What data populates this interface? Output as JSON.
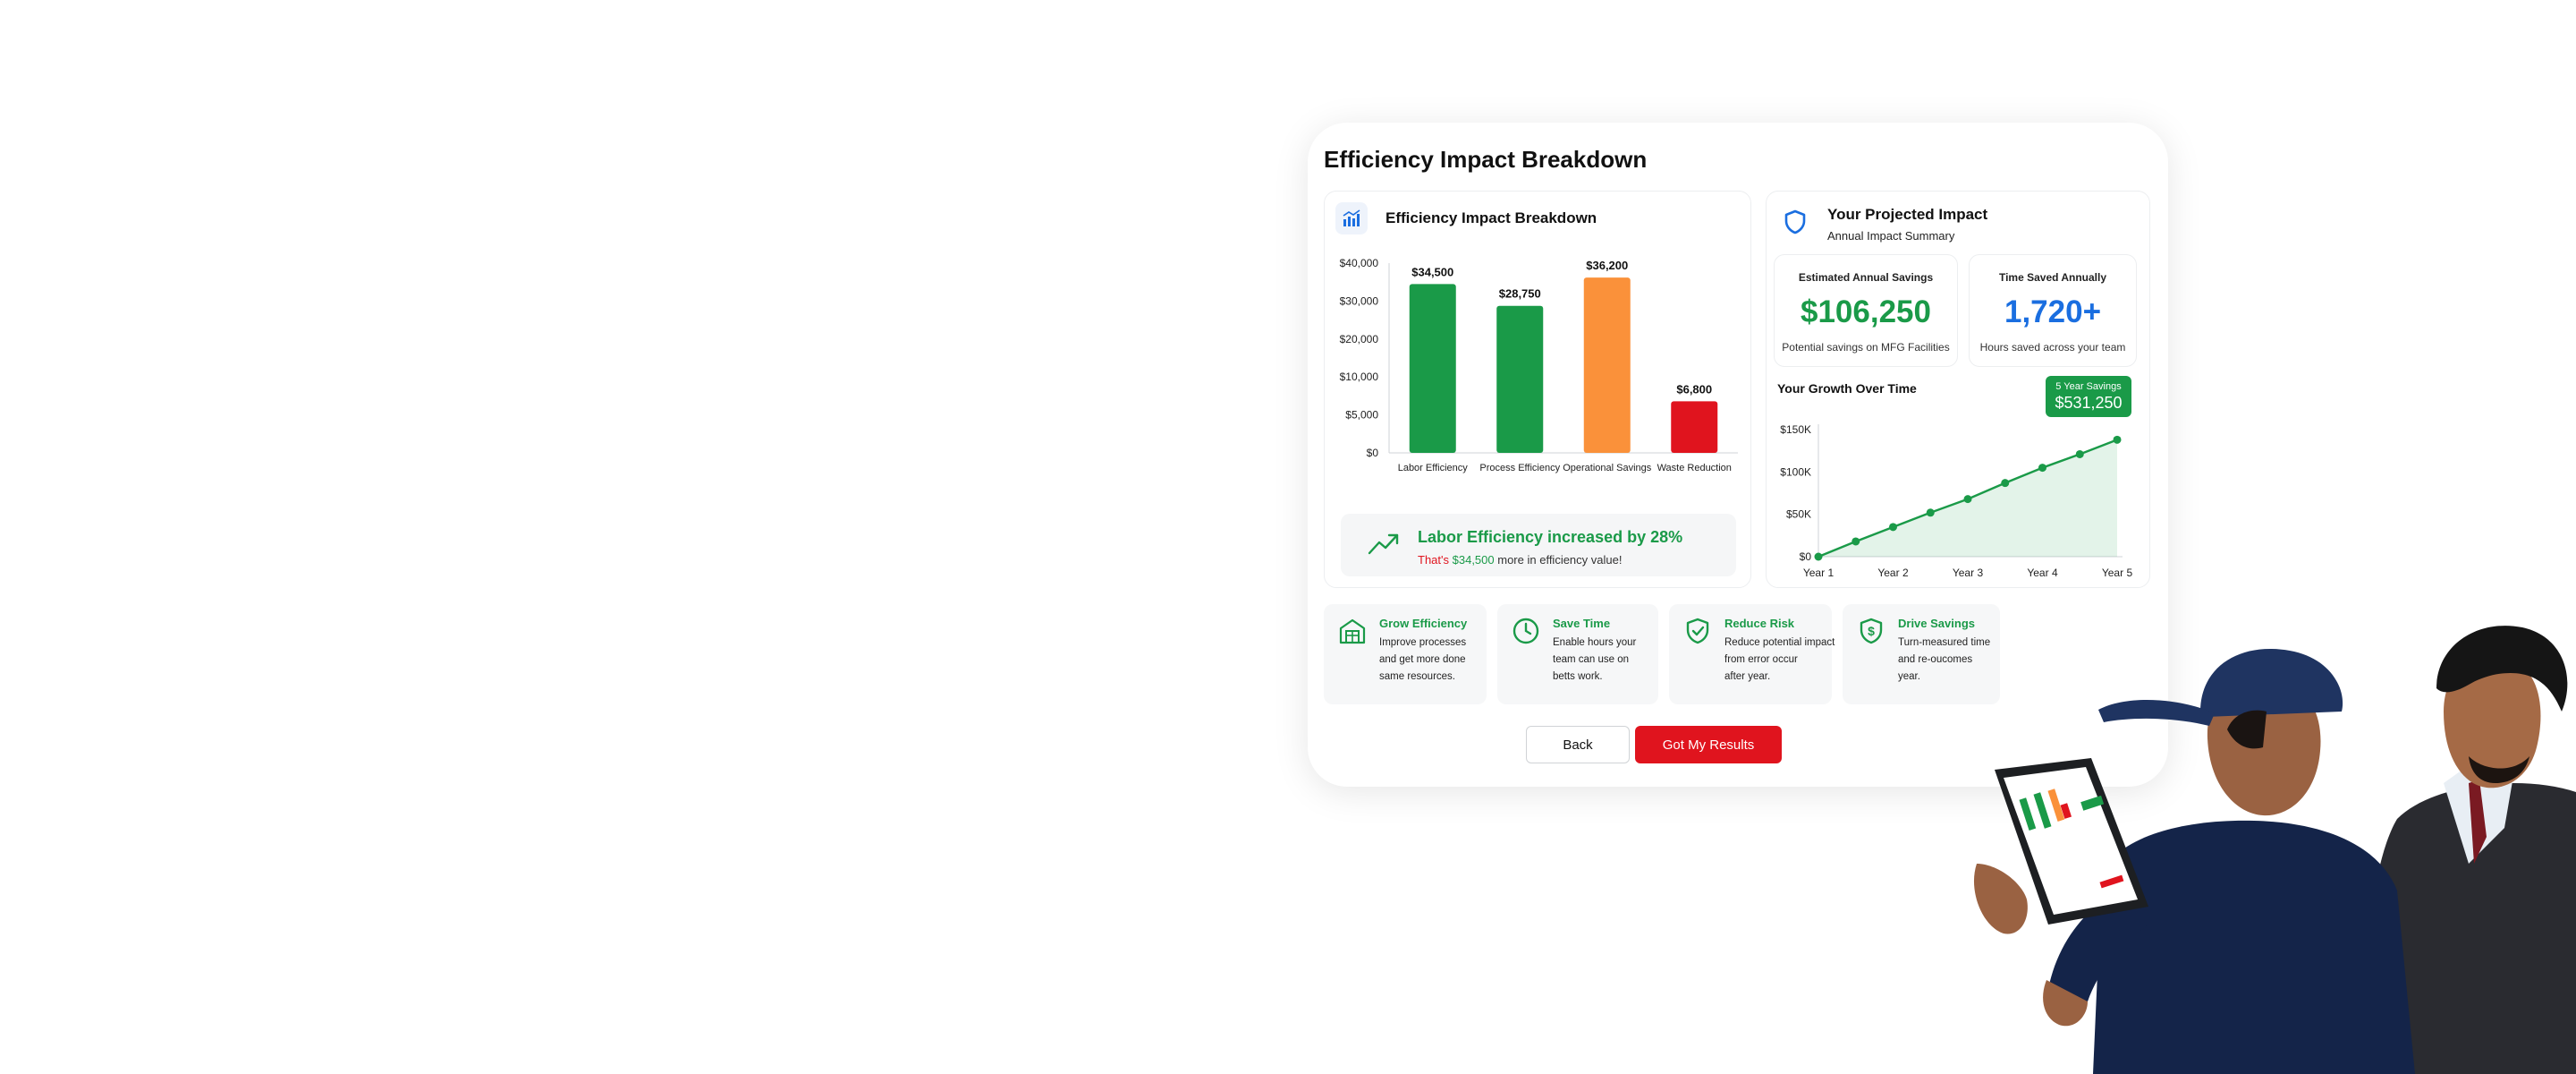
{
  "card": {
    "title": "Efficiency Impact Breakdown"
  },
  "left_panel": {
    "title": "Efficiency Impact Breakdown",
    "icon": "bar-chart-icon",
    "insight": {
      "icon": "trending-up-icon",
      "title": "Labor Efficiency increased by 28%",
      "prefix": "That's",
      "amount": "$34,500",
      "suffix": "more in efficiency value!"
    }
  },
  "right_panel": {
    "title": "Your Projected Impact",
    "subtitle": "Annual Impact Summary",
    "icon": "shield-icon",
    "stats": [
      {
        "label": "Estimated Annual Savings",
        "value": "$106,250",
        "desc": "Potential savings on MFG Facilities",
        "color": "#1a9a48"
      },
      {
        "label": "Time Saved Annually",
        "value": "1,720+",
        "desc": "Hours saved across your team",
        "color": "#1a6ee0"
      }
    ],
    "growth_title": "Your Growth Over Time",
    "badge": {
      "label": "5 Year Savings",
      "value": "$531,250"
    }
  },
  "features": [
    {
      "title": "Grow Efficiency",
      "icon": "warehouse-icon",
      "lines": [
        "Improve processes",
        "and get more done",
        "same resources."
      ]
    },
    {
      "title": "Save Time",
      "icon": "clock-icon",
      "lines": [
        "Enable hours your",
        "team can use on",
        "betts work."
      ]
    },
    {
      "title": "Reduce Risk",
      "icon": "shield-check-icon",
      "lines": [
        "Reduce potential impact",
        "from error occur",
        "after year."
      ]
    },
    {
      "title": "Drive Savings",
      "icon": "dollar-shield-icon",
      "lines": [
        "Turn-measured time",
        "and re-oucomes",
        "year."
      ]
    }
  ],
  "buttons": {
    "back": "Back",
    "results": "Got My Results"
  },
  "colors": {
    "green": "#1a9a48",
    "orange": "#fa913a",
    "red": "#e0141e",
    "blue": "#1a6ee0"
  },
  "chart_data": [
    {
      "type": "bar",
      "title": "",
      "categories": [
        "Labor Efficiency",
        "Process Efficiency",
        "Operational Savings",
        "Waste Reduction"
      ],
      "values": [
        34500,
        28750,
        36200,
        6800
      ],
      "value_labels": [
        "$34,500",
        "$28,750",
        "$36,200",
        "$6,800"
      ],
      "bar_colors": [
        "#1a9a48",
        "#1a9a48",
        "#fa913a",
        "#e0141e"
      ],
      "ylim": [
        0,
        40000
      ],
      "yticks": [
        0,
        5000,
        10000,
        20000,
        30000,
        40000
      ],
      "ytick_labels": [
        "$0",
        "$5,000",
        "$10,000",
        "$20,000",
        "$30,000",
        "$40,000"
      ],
      "grid": false
    },
    {
      "type": "area",
      "title": "",
      "x": [
        1,
        1.5,
        2,
        2.5,
        3,
        3.5,
        4,
        4.5,
        5
      ],
      "y": [
        0,
        18000,
        35000,
        52000,
        68000,
        87000,
        105000,
        121000,
        138000
      ],
      "xtick_values": [
        1,
        2,
        3,
        4,
        5
      ],
      "xtick_labels": [
        "Year 1",
        "Year 2",
        "Year 3",
        "Year 4",
        "Year 5"
      ],
      "ylim": [
        0,
        150000
      ],
      "yticks": [
        0,
        50000,
        100000,
        150000
      ],
      "ytick_labels": [
        "$0",
        "$50K",
        "$100K",
        "$150K"
      ],
      "color": "#1a9a48",
      "grid": false
    }
  ]
}
